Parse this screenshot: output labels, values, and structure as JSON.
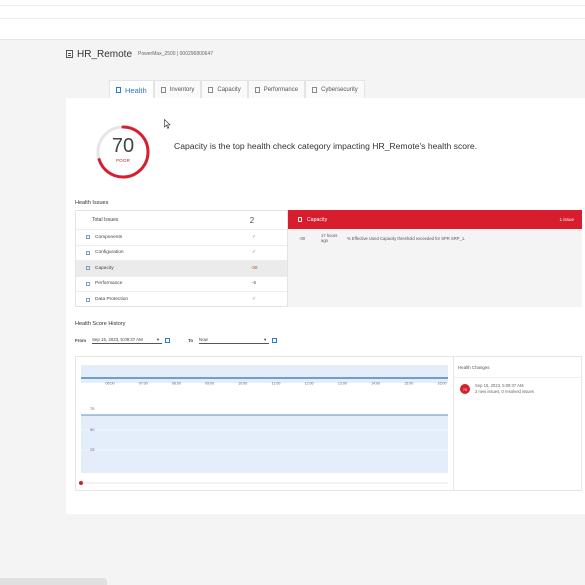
{
  "system": {
    "name": "HR_Remote",
    "model": "PowerMax_2500 | 000296800647"
  },
  "tabs": [
    {
      "label": "Health",
      "icon": "health-icon",
      "active": true
    },
    {
      "label": "Inventory",
      "icon": "inventory-icon",
      "active": false
    },
    {
      "label": "Capacity",
      "icon": "capacity-icon",
      "active": false
    },
    {
      "label": "Performance",
      "icon": "performance-icon",
      "active": false
    },
    {
      "label": "Cybersecurity",
      "icon": "shield-icon",
      "active": false
    }
  ],
  "health": {
    "score": "70",
    "rating": "POOR",
    "score_fraction": 0.7,
    "headline": "Capacity is the top health check category impacting HR_Remote's health score."
  },
  "health_issues": {
    "title": "Health Issues",
    "total_label": "Total Issues",
    "total_value": "2",
    "categories": [
      {
        "label": "Components",
        "value": "✓",
        "icon": "components-icon"
      },
      {
        "label": "Configuration",
        "value": "✓",
        "icon": "configuration-icon"
      },
      {
        "label": "Capacity",
        "value": "-30",
        "icon": "capacity-icon"
      },
      {
        "label": "Performance",
        "value": "-5",
        "icon": "performance-icon"
      },
      {
        "label": "Data Protection",
        "value": "✓",
        "icon": "data-protection-icon"
      }
    ],
    "detail": {
      "category": "Capacity",
      "count": "1 issue",
      "items": [
        {
          "score": "-30",
          "ago": "17 hours ago",
          "text": "% Effective Used Capacity threshold exceeded for SPR SRP_1."
        }
      ]
    }
  },
  "history": {
    "title": "Health Score History",
    "from_label": "From",
    "from_value": "Sep 15, 2023, 5:09:37 AM",
    "to_label": "To",
    "to_value": "Now",
    "time_ticks": [
      "06:00",
      "07:00",
      "08:00",
      "09:00",
      "10:00",
      "11:00",
      "12:00",
      "13:00",
      "14:00",
      "15:00",
      "16:00"
    ],
    "y_ticks": [
      "75",
      "50",
      "25"
    ],
    "changes": {
      "title": "Health Changes",
      "entry_badge": "70",
      "entry_date": "Sep 15, 2023, 5:09:37 AM",
      "entry_summary": "2 new issues, 0 resolved issues"
    }
  },
  "colors": {
    "accent": "#2a7bd0",
    "danger": "#d81e2e",
    "chart_fill": "#e3eefa",
    "chart_line": "#2f6db5"
  }
}
